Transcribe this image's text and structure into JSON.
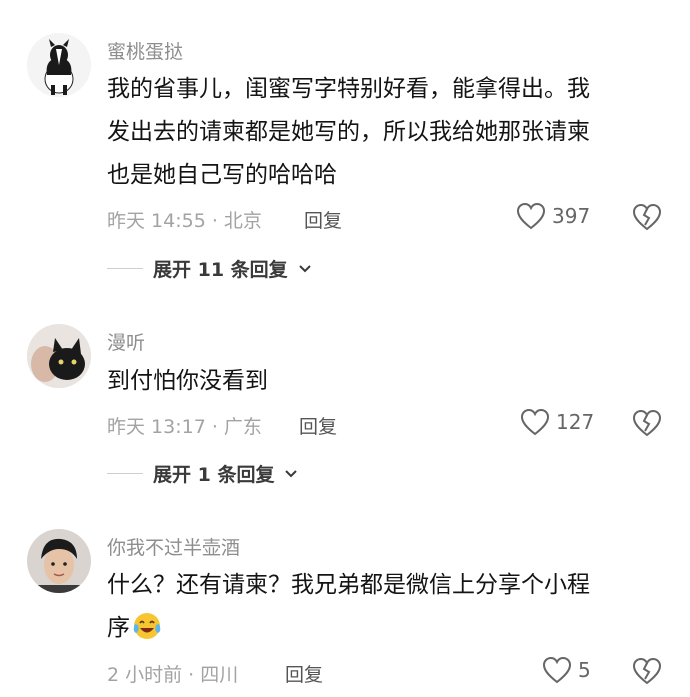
{
  "colors": {
    "text_primary": "#141414",
    "text_secondary": "#8e8e8e",
    "meta": "#a3a3a3",
    "icon": "#666666"
  },
  "comments": [
    {
      "username": "蜜桃蛋挞",
      "content": "我的省事儿，闺蜜写字特别好看，能拿得出。我\n发出去的请柬都是她写的，所以我给她那张请柬\n也是她自己写的哈哈哈",
      "meta": "昨天 14:55 · 北京",
      "reply_label": "回复",
      "likes": "397",
      "expand_label": "展开 11 条回复",
      "avatar": "dog-avatar"
    },
    {
      "username": "漫听",
      "content": "到付怕你没看到",
      "meta": "昨天 13:17 · 广东",
      "reply_label": "回复",
      "likes": "127",
      "expand_label": "展开 1 条回复",
      "avatar": "cat-avatar"
    },
    {
      "username": "你我不过半壶酒",
      "content": "什么？还有请柬？我兄弟都是微信上分享个小程\n序",
      "meta": "2 小时前 · 四川",
      "reply_label": "回复",
      "likes": "5",
      "avatar": "person-avatar",
      "emoji": "crying-laughing-emoji"
    }
  ]
}
